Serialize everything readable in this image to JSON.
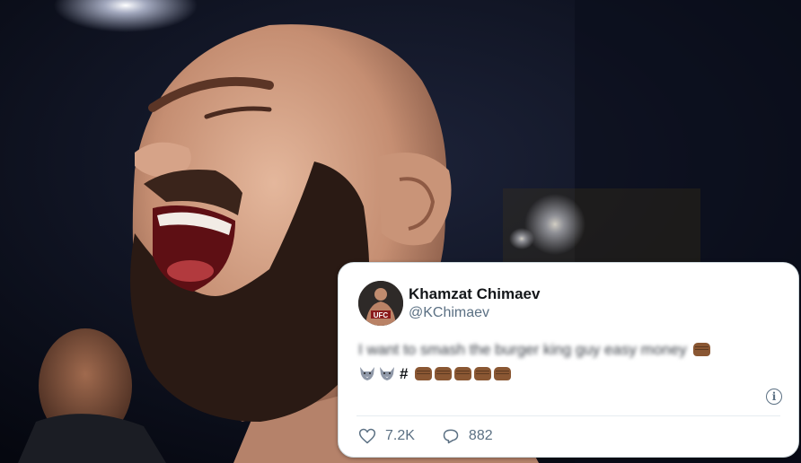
{
  "tweet": {
    "display_name": "Khamzat Chimaev",
    "handle": "@KChimaev",
    "text": "I want to smash the burger king guy easy money",
    "hashtag": "#",
    "likes": "7.2K",
    "replies": "882",
    "avatar_logo": "UFC"
  },
  "colors": {
    "card_background": "#ffffff",
    "secondary_text": "#5b7083",
    "fist_emoji": "#8a5733"
  },
  "icons": [
    "wolf-emoji-icon",
    "oncoming-fist-emoji-icon",
    "info-icon",
    "heart-icon",
    "reply-icon"
  ]
}
